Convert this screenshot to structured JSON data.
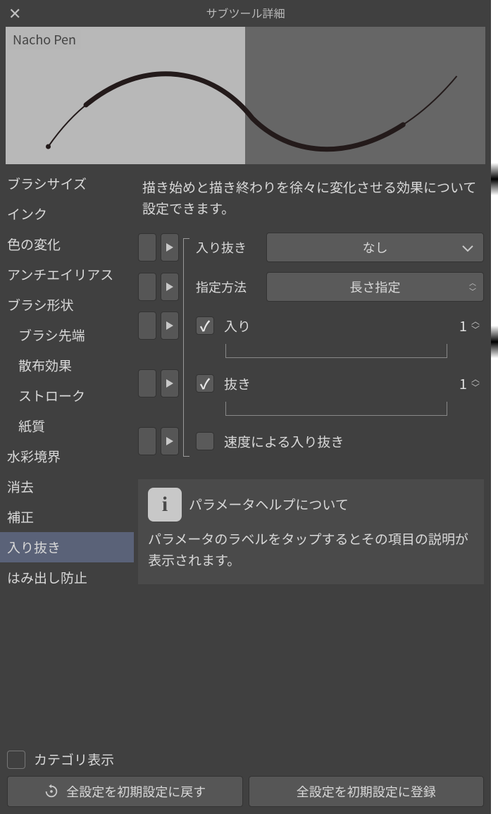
{
  "title": "サブツール詳細",
  "brush_name": "Nacho Pen",
  "sidebar": {
    "items": [
      {
        "label": "ブラシサイズ"
      },
      {
        "label": "インク"
      },
      {
        "label": "色の変化"
      },
      {
        "label": "アンチエイリアス"
      },
      {
        "label": "ブラシ形状"
      },
      {
        "label": "ブラシ先端",
        "indent": true
      },
      {
        "label": "散布効果",
        "indent": true
      },
      {
        "label": "ストローク",
        "indent": true
      },
      {
        "label": "紙質",
        "indent": true
      },
      {
        "label": "水彩境界"
      },
      {
        "label": "消去"
      },
      {
        "label": "補正"
      },
      {
        "label": "入り抜き",
        "selected": true
      },
      {
        "label": "はみ出し防止"
      }
    ]
  },
  "content": {
    "description": "描き始めと描き終わりを徐々に変化させる効果について設定できます。",
    "params": {
      "starting_ending": {
        "label": "入り抜き",
        "value": "なし"
      },
      "method": {
        "label": "指定方法",
        "value": "長さ指定"
      },
      "start": {
        "label": "入り",
        "checked": true,
        "value": "1"
      },
      "end": {
        "label": "抜き",
        "checked": true,
        "value": "1"
      },
      "speed": {
        "label": "速度による入り抜き",
        "checked": false
      }
    }
  },
  "help": {
    "title": "パラメータヘルプについて",
    "text": "パラメータのラベルをタップするとその項目の説明が表示されます。"
  },
  "footer": {
    "category_label": "カテゴリ表示",
    "reset_label": "全設定を初期設定に戻す",
    "register_label": "全設定を初期設定に登録"
  }
}
